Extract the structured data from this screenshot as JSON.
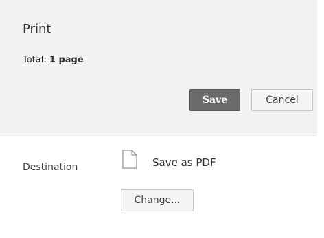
{
  "dialog": {
    "title": "Print",
    "total_prefix": "Total:",
    "total_value": "1 page"
  },
  "buttons": {
    "save_label": "Save",
    "cancel_label": "Cancel",
    "change_label": "Change..."
  },
  "destination": {
    "label": "Destination",
    "name": "Save as PDF",
    "icon": "document-icon"
  },
  "colors": {
    "header_bg": "#f2f2f2",
    "primary_button": "#6b6b6b"
  }
}
